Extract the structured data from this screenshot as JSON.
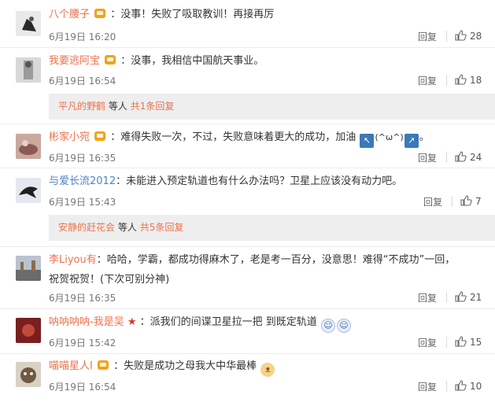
{
  "comments": [
    {
      "user": "八个腰子",
      "content": "：没事！失败了吸取教训！再接再厉",
      "time": "6月19日 16:20",
      "reply": "回复",
      "likes": "28"
    },
    {
      "user": "我要逃阿宝",
      "content": "：没事，我相信中国航天事业。",
      "time": "6月19日 16:54",
      "reply": "回复",
      "likes": "18",
      "sub": {
        "user": "平凡的野鹤",
        "text": "等人",
        "count": "共1条回复"
      }
    },
    {
      "user": "彬家小宛",
      "content": "：难得失败一次，不过，失败意味着更大的成功，加油",
      "emoji_text": "(^ω^)",
      "time": "6月19日 16:35",
      "reply": "回复",
      "likes": "24"
    },
    {
      "user": "与爱长流2012",
      "content": "：未能进入预定轨道也有什么办法吗？卫星上应该没有动力吧。",
      "time": "6月19日 15:43",
      "reply": "回复",
      "likes": "7",
      "sub": {
        "user": "安静的赶花会",
        "text": "等人",
        "count": "共5条回复"
      }
    },
    {
      "user": "李Liyou有",
      "content": "：哈哈，学霸，都成功得麻木了，老是考一百分，没意思！难得“不成功”一回，祝贺祝贺！(下次可别分神)",
      "time": "6月19日 16:35",
      "reply": "回复",
      "likes": "21"
    },
    {
      "user": "呐呐呐呐-我是吴",
      "content": "：派我们的间谍卫星拉一把 到既定轨道",
      "time": "6月19日 15:42",
      "reply": "回复",
      "likes": "15"
    },
    {
      "user": "喵喵星人I",
      "content": "：失败是成功之母我大中华最棒",
      "time": "6月19日 16:54",
      "reply": "回复",
      "likes": "10"
    }
  ],
  "icons": {
    "like": "thumbs-up-icon",
    "vip": "vip-badge-icon"
  },
  "colors": {
    "username": "#eb7350",
    "sub_reply_bg": "#eeeeee"
  }
}
